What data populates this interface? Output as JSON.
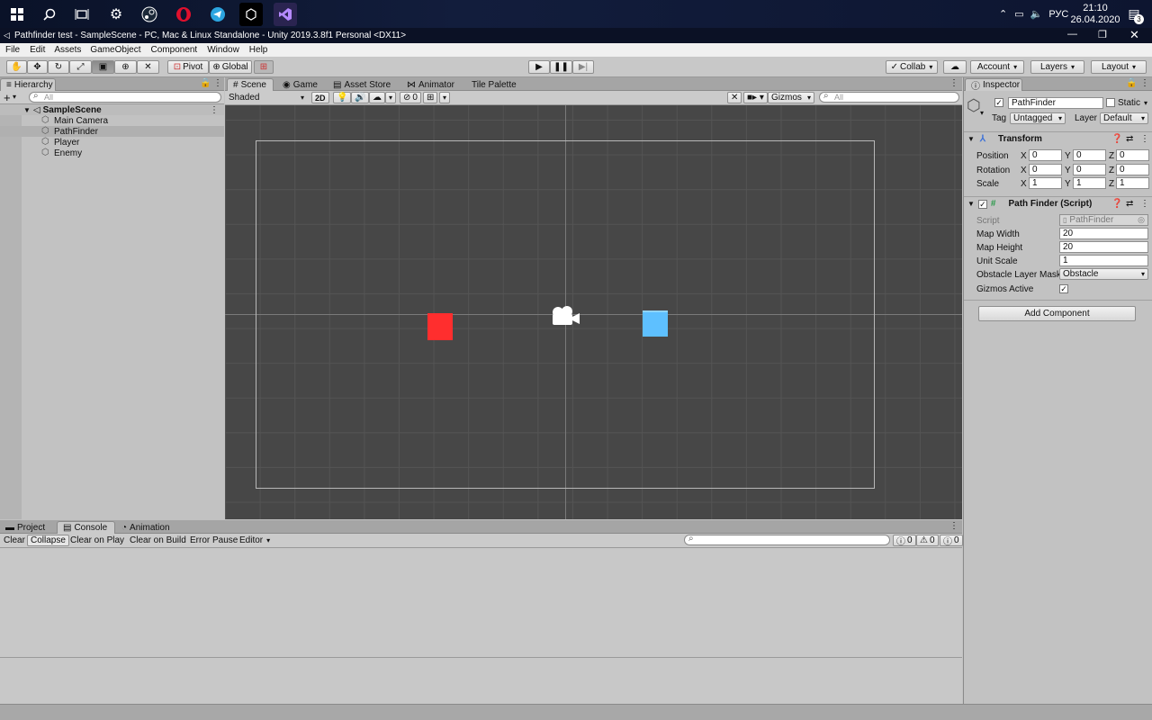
{
  "taskbar": {
    "icons": [
      "windows-icon",
      "search-icon",
      "task-view-icon",
      "settings-icon",
      "steam-icon",
      "opera-icon",
      "telegram-icon",
      "unity-icon",
      "visual-studio-icon"
    ],
    "tray": {
      "lang": "РУС",
      "time": "21:10",
      "date": "26.04.2020",
      "notif_count": "3"
    }
  },
  "window": {
    "title": "Pathfinder test - SampleScene - PC, Mac & Linux Standalone - Unity 2019.3.8f1 Personal <DX11>"
  },
  "menu": [
    "File",
    "Edit",
    "Assets",
    "GameObject",
    "Component",
    "Window",
    "Help"
  ],
  "toolbar": {
    "pivot": "Pivot",
    "global": "Global",
    "collab": "Collab",
    "account": "Account",
    "layers": "Layers",
    "layout": "Layout"
  },
  "hierarchy": {
    "tab": "Hierarchy",
    "search_placeholder": "All",
    "scene": "SampleScene",
    "items": [
      "Main Camera",
      "PathFinder",
      "Player",
      "Enemy"
    ]
  },
  "scene_view": {
    "tabs": [
      "Scene",
      "Game",
      "Asset Store",
      "Animator",
      "Tile Palette"
    ],
    "shading": "Shaded",
    "mode2d": "2D",
    "hidden_count": "0",
    "gizmos": "Gizmos",
    "search_placeholder": "All",
    "colors": {
      "enemy": "#ff2e2e",
      "player": "#5ec0ff",
      "background": "#474747"
    }
  },
  "inspector": {
    "tab": "Inspector",
    "object_name": "PathFinder",
    "static": "Static",
    "tag_label": "Tag",
    "tag": "Untagged",
    "layer_label": "Layer",
    "layer": "Default",
    "transform": {
      "title": "Transform",
      "rows": [
        {
          "label": "Position",
          "x": "0",
          "y": "0",
          "z": "0"
        },
        {
          "label": "Rotation",
          "x": "0",
          "y": "0",
          "z": "0"
        },
        {
          "label": "Scale",
          "x": "1",
          "y": "1",
          "z": "1"
        }
      ],
      "x": "X",
      "y": "Y",
      "z": "Z"
    },
    "script": {
      "title": "Path Finder (Script)",
      "script_label": "Script",
      "script_value": "PathFinder",
      "map_width_label": "Map Width",
      "map_width": "20",
      "map_height_label": "Map Height",
      "map_height": "20",
      "unit_scale_label": "Unit Scale",
      "unit_scale": "1",
      "obstacle_label": "Obstacle Layer Mask",
      "obstacle": "Obstacle",
      "gizmos_label": "Gizmos Active"
    },
    "add_component": "Add Component"
  },
  "console": {
    "tabs": [
      "Project",
      "Console",
      "Animation"
    ],
    "buttons": [
      "Clear",
      "Collapse",
      "Clear on Play",
      "Clear on Build",
      "Error Pause",
      "Editor"
    ],
    "counts": {
      "errors": "0",
      "warnings": "0",
      "messages": "0"
    }
  }
}
